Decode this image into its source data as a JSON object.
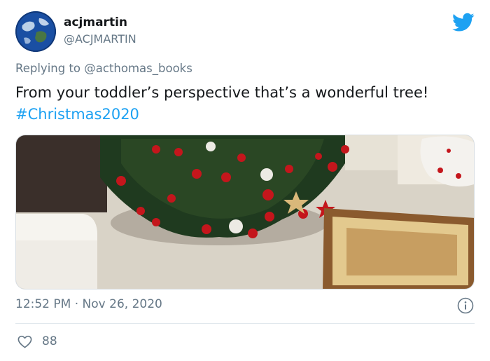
{
  "tweet": {
    "display_name": "acjmartin",
    "handle": "@ACJMARTIN",
    "reply_prefix": "Replying to ",
    "reply_to": "@acthomas_books",
    "text": "From your toddler’s perspective that’s a wonderful tree! ",
    "hashtag": "#Christmas2020",
    "time": "12:52 PM",
    "separator": " · ",
    "date": "Nov 26, 2020",
    "likes": "88"
  },
  "icons": {
    "brand": "twitter-bird-icon",
    "info": "info-icon",
    "like": "heart-icon"
  },
  "colors": {
    "accent": "#1da1f2",
    "secondary_text": "#657786",
    "primary_text": "#14171a",
    "divider": "#e1e8ed"
  }
}
